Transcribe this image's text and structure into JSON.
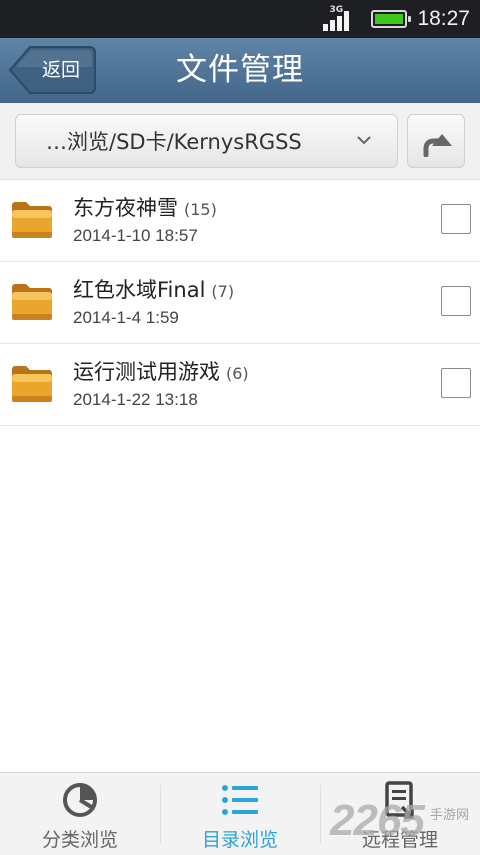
{
  "status_bar": {
    "network": "3G",
    "time": "18:27",
    "battery_color": "#3ec81d"
  },
  "header": {
    "back_label": "返回",
    "title": "文件管理"
  },
  "path_bar": {
    "path": "…浏览/SD卡/KernysRGSS",
    "dropdown_icon": "chevron-down-icon",
    "up_icon": "up-arrow-icon"
  },
  "files": [
    {
      "name": "东方夜神雪",
      "count": "(15)",
      "date": "2014-1-10 18:57",
      "icon": "folder-icon",
      "checked": false
    },
    {
      "name": "红色水域Final",
      "count": "(7)",
      "date": "2014-1-4 1:59",
      "icon": "folder-icon",
      "checked": false
    },
    {
      "name": "运行测试用游戏",
      "count": "(6)",
      "date": "2014-1-22 13:18",
      "icon": "folder-icon",
      "checked": false
    }
  ],
  "bottom_nav": [
    {
      "label": "分类浏览",
      "icon": "pie-chart-icon",
      "active": false
    },
    {
      "label": "目录浏览",
      "icon": "list-icon",
      "active": true
    },
    {
      "label": "远程管理",
      "icon": "remote-device-icon",
      "active": false
    }
  ],
  "watermark": {
    "text": "2265",
    "sub": "手游网"
  },
  "colors": {
    "title_bar": "#4f7396",
    "accent": "#2aa5d9",
    "folder": "#e9a62c"
  }
}
